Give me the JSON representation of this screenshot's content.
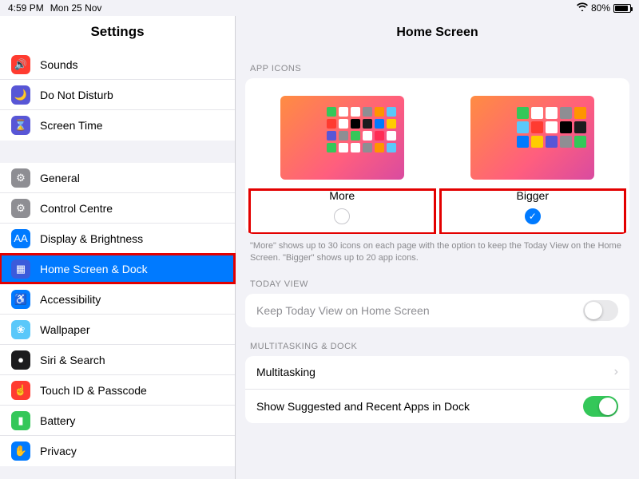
{
  "status": {
    "time": "4:59 PM",
    "date": "Mon 25 Nov",
    "battery_pct": "80%"
  },
  "sidebar": {
    "title": "Settings",
    "group1": [
      {
        "label": "Sounds",
        "bg": "#ff3b30"
      },
      {
        "label": "Do Not Disturb",
        "bg": "#5856d6"
      },
      {
        "label": "Screen Time",
        "bg": "#5856d6"
      }
    ],
    "group2": [
      {
        "label": "General",
        "bg": "#8e8e93"
      },
      {
        "label": "Control Centre",
        "bg": "#8e8e93"
      },
      {
        "label": "Display & Brightness",
        "bg": "#007aff"
      },
      {
        "label": "Home Screen & Dock",
        "bg": "#3b5bdb"
      },
      {
        "label": "Accessibility",
        "bg": "#007aff"
      },
      {
        "label": "Wallpaper",
        "bg": "#5ac8fa"
      },
      {
        "label": "Siri & Search",
        "bg": "#1c1c1e"
      },
      {
        "label": "Touch ID & Passcode",
        "bg": "#ff3b30"
      },
      {
        "label": "Battery",
        "bg": "#34c759"
      },
      {
        "label": "Privacy",
        "bg": "#007aff"
      }
    ]
  },
  "main": {
    "title": "Home Screen",
    "section_app_icons": "APP ICONS",
    "option_more": "More",
    "option_bigger": "Bigger",
    "footnote": "\"More\" shows up to 30 icons on each page with the option to keep the Today View on the Home Screen. \"Bigger\" shows up to 20 app icons.",
    "section_today": "TODAY VIEW",
    "today_label": "Keep Today View on Home Screen",
    "section_multi": "MULTITASKING & DOCK",
    "multitasking": "Multitasking",
    "suggested": "Show Suggested and Recent Apps in Dock"
  },
  "colors": {
    "accent": "#007aff",
    "green": "#34c759"
  }
}
